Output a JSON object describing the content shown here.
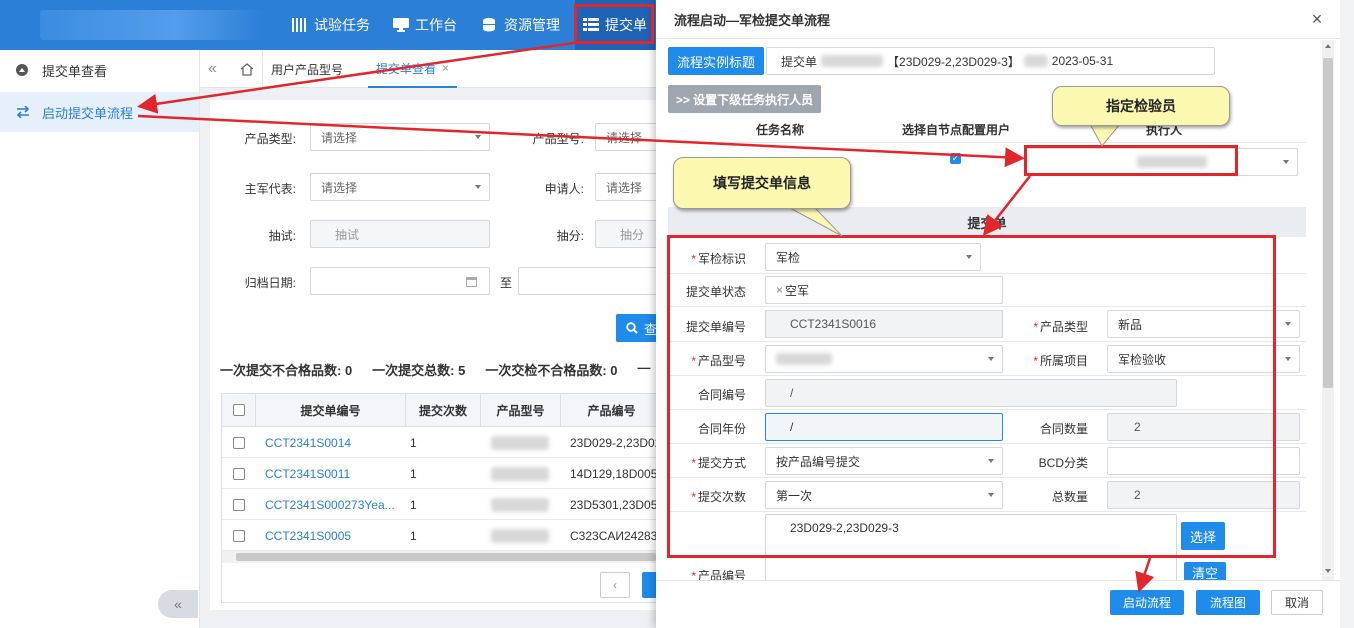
{
  "nav": {
    "items": [
      {
        "label": "试验任务",
        "icon": "grid-icon"
      },
      {
        "label": "工作台",
        "icon": "monitor-icon"
      },
      {
        "label": "资源管理",
        "icon": "database-icon"
      },
      {
        "label": "提交单",
        "icon": "list-icon"
      }
    ]
  },
  "sidebar": {
    "items": [
      {
        "label": "提交单查看"
      },
      {
        "label": "启动提交单流程"
      }
    ],
    "collapse": "«"
  },
  "tabs": {
    "items": [
      {
        "label": "用户产品型号"
      },
      {
        "label": "提交单查看"
      }
    ]
  },
  "filters": {
    "product_type_label": "产品类型:",
    "product_type_value": "请选择",
    "product_model_label": "产品型号:",
    "product_model_value": "请选择",
    "military_rep_label": "主军代表:",
    "military_rep_value": "请选择",
    "applicant_label": "申请人:",
    "applicant_value": "请选择",
    "sample_test_label": "抽试:",
    "sample_test_placeholder": "抽试",
    "sample_score_label": "抽分:",
    "sample_score_placeholder": "抽分",
    "archive_date_label": "归档日期:",
    "to_label": "至",
    "search_label": "查"
  },
  "stats": {
    "first_unqualified": "一次提交不合格品数: 0",
    "first_total": "一次提交总数: 5",
    "first_inspect_unqualified": "一次交检不合格品数: 0",
    "more": "—"
  },
  "grid": {
    "headers": [
      "提交单编号",
      "提交次数",
      "产品型号",
      "产品编号"
    ],
    "rows": [
      {
        "id": "CCT2341S0014",
        "count": "1",
        "product_no": "23D029-2,23D02"
      },
      {
        "id": "CCT2341S0011",
        "count": "1",
        "product_no": "14D129,18D005"
      },
      {
        "id": "CCT2341S000273Yea...",
        "count": "1",
        "product_no": "23D5301,23D05"
      },
      {
        "id": "CCT2341S0005",
        "count": "1",
        "product_no": "C323CAИ24283"
      }
    ]
  },
  "modal": {
    "title": "流程启动—军检提交单流程",
    "close": "×",
    "instance_title_btn": "流程实例标题",
    "instance_title_value_a": "提交单",
    "instance_title_value_b": "【23D029-2,23D029-3】",
    "instance_title_value_c": "2023-05-31",
    "set_executor_btn": ">> 设置下级任务执行人员",
    "col_task_name": "任务名称",
    "col_select_user": "选择自节点配置用户",
    "col_executor": "执行人",
    "section_title": "提交单",
    "fields": {
      "mil_flag_label": "军检标识",
      "mil_flag_value": "军检",
      "status_label": "提交单状态",
      "status_tag": "空军",
      "order_no_label": "提交单编号",
      "order_no_value": "CCT2341S0016",
      "product_type_label": "产品类型",
      "product_type_value": "新品",
      "product_model_label": "产品型号",
      "project_label": "所属项目",
      "project_value": "军检验收",
      "contract_no_label": "合同编号",
      "contract_no_value": "/",
      "contract_year_label": "合同年份",
      "contract_year_value": "/",
      "contract_qty_label": "合同数量",
      "contract_qty_value": "2",
      "submit_mode_label": "提交方式",
      "submit_mode_value": "按产品编号提交",
      "bcd_label": "BCD分类",
      "submit_times_label": "提交次数",
      "submit_times_value": "第一次",
      "total_label": "总数量",
      "total_value": "2",
      "product_nos_value": "23D029-2,23D029-3",
      "select_btn": "选择",
      "product_no_label": "产品编号",
      "clear_btn": "清空"
    },
    "footer": {
      "start": "启动流程",
      "flowchart": "流程图",
      "cancel": "取消"
    }
  },
  "annotations": {
    "callout_inspector": "指定检验员",
    "callout_fill": "填写提交单信息"
  },
  "colors": {
    "primary": "#1f8ceb",
    "topbar": "#2b7fd7",
    "highlight": "#e3262b",
    "callout": "#fbf8b0"
  }
}
